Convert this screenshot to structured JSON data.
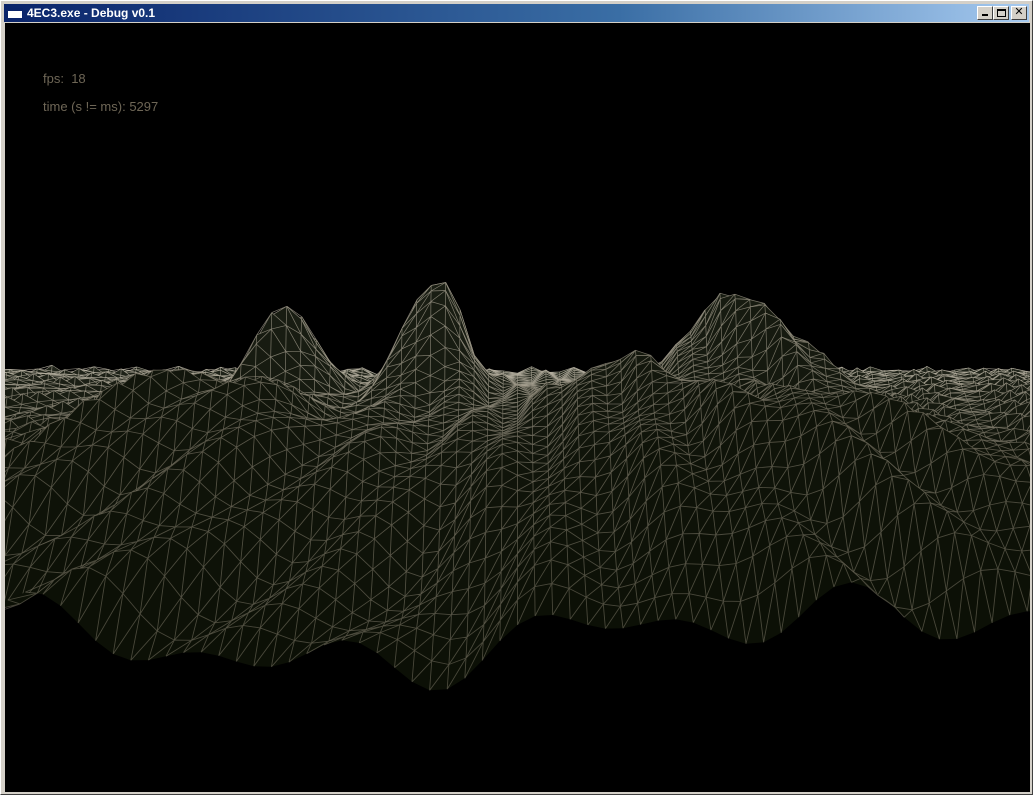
{
  "window": {
    "title": "4EC3.exe - Debug v0.1",
    "icon": "application-window-icon",
    "buttons": {
      "minimize": "minimize-icon",
      "maximize": "maximize-icon",
      "close_glyph": "✕"
    }
  },
  "hud": {
    "fps_label": "fps:",
    "fps_value": "18",
    "time_label": "time (s != ms):",
    "time_value": "5297"
  },
  "scene": {
    "render_mode": "wireframe terrain",
    "background_color": "#000000",
    "wire_color_near": "#8c8678",
    "wire_color_far": "#bdb5a2",
    "fill_color": "#2b3322"
  }
}
